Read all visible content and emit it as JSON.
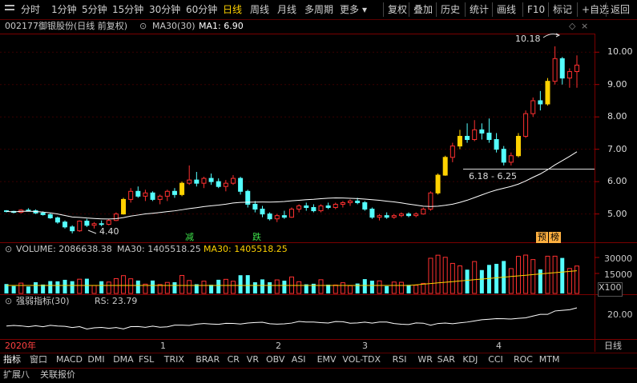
{
  "toolbar": {
    "periods": [
      "分时",
      "1分钟",
      "5分钟",
      "15分钟",
      "30分钟",
      "60分钟",
      "日线",
      "周线",
      "月线",
      "多周期",
      "更多"
    ],
    "active_period": "日线",
    "tools": [
      "复权",
      "叠加",
      "历史",
      "统计",
      "画线",
      "F10",
      "标记",
      "+自选",
      "返回"
    ]
  },
  "stock": {
    "code": "002177",
    "name": "御银股份(日线 前复权)",
    "ma_label": "MA30(30)",
    "ma_value": "MA1: 6.90"
  },
  "annotations": {
    "high": "10.18",
    "low": "4.40",
    "range": "6.18 - 6.25",
    "event1": "减",
    "event2": "跌",
    "event3": "预",
    "event4": "榜"
  },
  "price_axis": [
    "10.00",
    "9.00",
    "8.00",
    "7.00",
    "6.00",
    "5.00"
  ],
  "volume": {
    "label": "VOLUME: 2086638.38",
    "ma_a": "MA30: 1405518.25",
    "ma_b": "MA30: 1405518.25",
    "axis": [
      "30000",
      "15000"
    ],
    "unit": "X100"
  },
  "rs": {
    "label": "强弱指标(30)",
    "value": "RS: 23.79",
    "axis": "20.00"
  },
  "date_axis": {
    "year": "2020年",
    "months": [
      "1",
      "2",
      "3",
      "4"
    ],
    "period": "日线"
  },
  "indicator_tabs": [
    "指标",
    "窗口",
    "MACD",
    "DMI",
    "DMA",
    "FSL",
    "TRIX",
    "BRAR",
    "CR",
    "VR",
    "OBV",
    "ASI",
    "EMV",
    "VOL-TDX",
    "RSI",
    "WR",
    "SAR",
    "KDJ",
    "CCI",
    "ROC",
    "MTM"
  ],
  "footer_tabs": [
    "扩展八",
    "关联报价"
  ],
  "colors": {
    "up": "#ff3030",
    "down": "#54ffff",
    "yellow": "#ffd200",
    "ma": "#ffffff",
    "grid": "#7a0000"
  },
  "chart_data": {
    "type": "candlestick",
    "candles": [
      [
        5.1,
        5.12,
        5.05,
        5.08
      ],
      [
        5.08,
        5.1,
        5.02,
        5.05
      ],
      [
        5.05,
        5.15,
        5.02,
        5.12
      ],
      [
        5.12,
        5.18,
        5.08,
        5.1
      ],
      [
        5.1,
        5.14,
        5.0,
        5.03
      ],
      [
        5.03,
        5.08,
        4.95,
        4.98
      ],
      [
        4.98,
        5.02,
        4.85,
        4.88
      ],
      [
        4.88,
        4.92,
        4.7,
        4.75
      ],
      [
        4.75,
        4.8,
        4.55,
        4.6
      ],
      [
        4.6,
        4.65,
        4.4,
        4.48
      ],
      [
        4.48,
        4.8,
        4.45,
        4.78
      ],
      [
        4.78,
        4.85,
        4.6,
        4.65
      ],
      [
        4.65,
        4.75,
        4.55,
        4.7
      ],
      [
        4.7,
        4.8,
        4.62,
        4.68
      ],
      [
        4.68,
        4.85,
        4.65,
        4.8
      ],
      [
        4.8,
        5.05,
        4.78,
        5.0
      ],
      [
        5.0,
        5.5,
        4.98,
        5.45
      ],
      [
        5.45,
        5.8,
        5.35,
        5.7
      ],
      [
        5.7,
        5.85,
        5.5,
        5.55
      ],
      [
        5.55,
        5.75,
        5.4,
        5.65
      ],
      [
        5.65,
        5.7,
        5.4,
        5.45
      ],
      [
        5.45,
        5.6,
        5.3,
        5.55
      ],
      [
        5.55,
        5.75,
        5.4,
        5.7
      ],
      [
        5.7,
        5.8,
        5.5,
        5.6
      ],
      [
        5.6,
        6.0,
        5.55,
        5.95
      ],
      [
        5.95,
        6.5,
        5.9,
        6.05
      ],
      [
        6.05,
        6.3,
        5.85,
        5.95
      ],
      [
        5.95,
        6.15,
        5.8,
        6.1
      ],
      [
        6.1,
        6.25,
        5.9,
        6.0
      ],
      [
        6.0,
        6.1,
        5.8,
        5.85
      ],
      [
        5.85,
        6.05,
        5.7,
        5.95
      ],
      [
        5.95,
        6.2,
        5.9,
        6.1
      ],
      [
        6.1,
        6.15,
        5.6,
        5.7
      ],
      [
        5.7,
        5.75,
        5.2,
        5.3
      ],
      [
        5.3,
        5.4,
        5.05,
        5.15
      ],
      [
        5.15,
        5.25,
        4.9,
        5.0
      ],
      [
        5.0,
        5.05,
        4.8,
        4.85
      ],
      [
        4.85,
        5.0,
        4.75,
        4.95
      ],
      [
        4.95,
        5.1,
        4.85,
        4.9
      ],
      [
        4.9,
        5.2,
        4.88,
        5.15
      ],
      [
        5.15,
        5.3,
        5.05,
        5.25
      ],
      [
        5.25,
        5.35,
        5.1,
        5.2
      ],
      [
        5.2,
        5.3,
        5.05,
        5.1
      ],
      [
        5.1,
        5.3,
        5.05,
        5.25
      ],
      [
        5.25,
        5.35,
        5.15,
        5.2
      ],
      [
        5.2,
        5.35,
        5.15,
        5.3
      ],
      [
        5.3,
        5.4,
        5.2,
        5.35
      ],
      [
        5.35,
        5.45,
        5.25,
        5.4
      ],
      [
        5.4,
        5.5,
        5.3,
        5.35
      ],
      [
        5.35,
        5.4,
        5.1,
        5.15
      ],
      [
        5.15,
        5.2,
        4.85,
        4.9
      ],
      [
        4.9,
        5.0,
        4.8,
        4.95
      ],
      [
        4.95,
        5.05,
        4.85,
        4.9
      ],
      [
        4.9,
        5.0,
        4.85,
        4.95
      ],
      [
        4.95,
        5.05,
        4.9,
        5.0
      ],
      [
        5.0,
        5.05,
        4.9,
        4.95
      ],
      [
        4.95,
        5.05,
        4.9,
        5.0
      ],
      [
        5.0,
        5.2,
        4.98,
        5.15
      ],
      [
        5.15,
        5.7,
        5.1,
        5.65
      ],
      [
        5.65,
        6.25,
        5.6,
        6.2
      ],
      [
        6.2,
        6.8,
        6.18,
        6.75
      ],
      [
        6.75,
        7.2,
        6.6,
        7.1
      ],
      [
        7.1,
        7.6,
        7.0,
        7.4
      ],
      [
        7.4,
        7.8,
        7.2,
        7.3
      ],
      [
        7.3,
        7.9,
        7.25,
        7.6
      ],
      [
        7.6,
        7.8,
        7.3,
        7.5
      ],
      [
        7.5,
        7.95,
        7.2,
        7.3
      ],
      [
        7.3,
        7.5,
        6.9,
        7.0
      ],
      [
        7.0,
        7.1,
        6.5,
        6.6
      ],
      [
        6.6,
        6.9,
        6.5,
        6.8
      ],
      [
        6.8,
        7.5,
        6.75,
        7.4
      ],
      [
        7.4,
        8.2,
        7.35,
        8.1
      ],
      [
        8.1,
        8.6,
        8.0,
        8.5
      ],
      [
        8.5,
        8.8,
        8.2,
        8.4
      ],
      [
        8.4,
        9.2,
        8.35,
        9.1
      ],
      [
        9.1,
        10.18,
        9.0,
        9.8
      ],
      [
        9.8,
        9.85,
        9.0,
        9.2
      ],
      [
        9.2,
        9.5,
        8.9,
        9.4
      ],
      [
        9.4,
        9.9,
        8.9,
        9.6
      ]
    ],
    "ylim": [
      4.2,
      10.5
    ]
  }
}
